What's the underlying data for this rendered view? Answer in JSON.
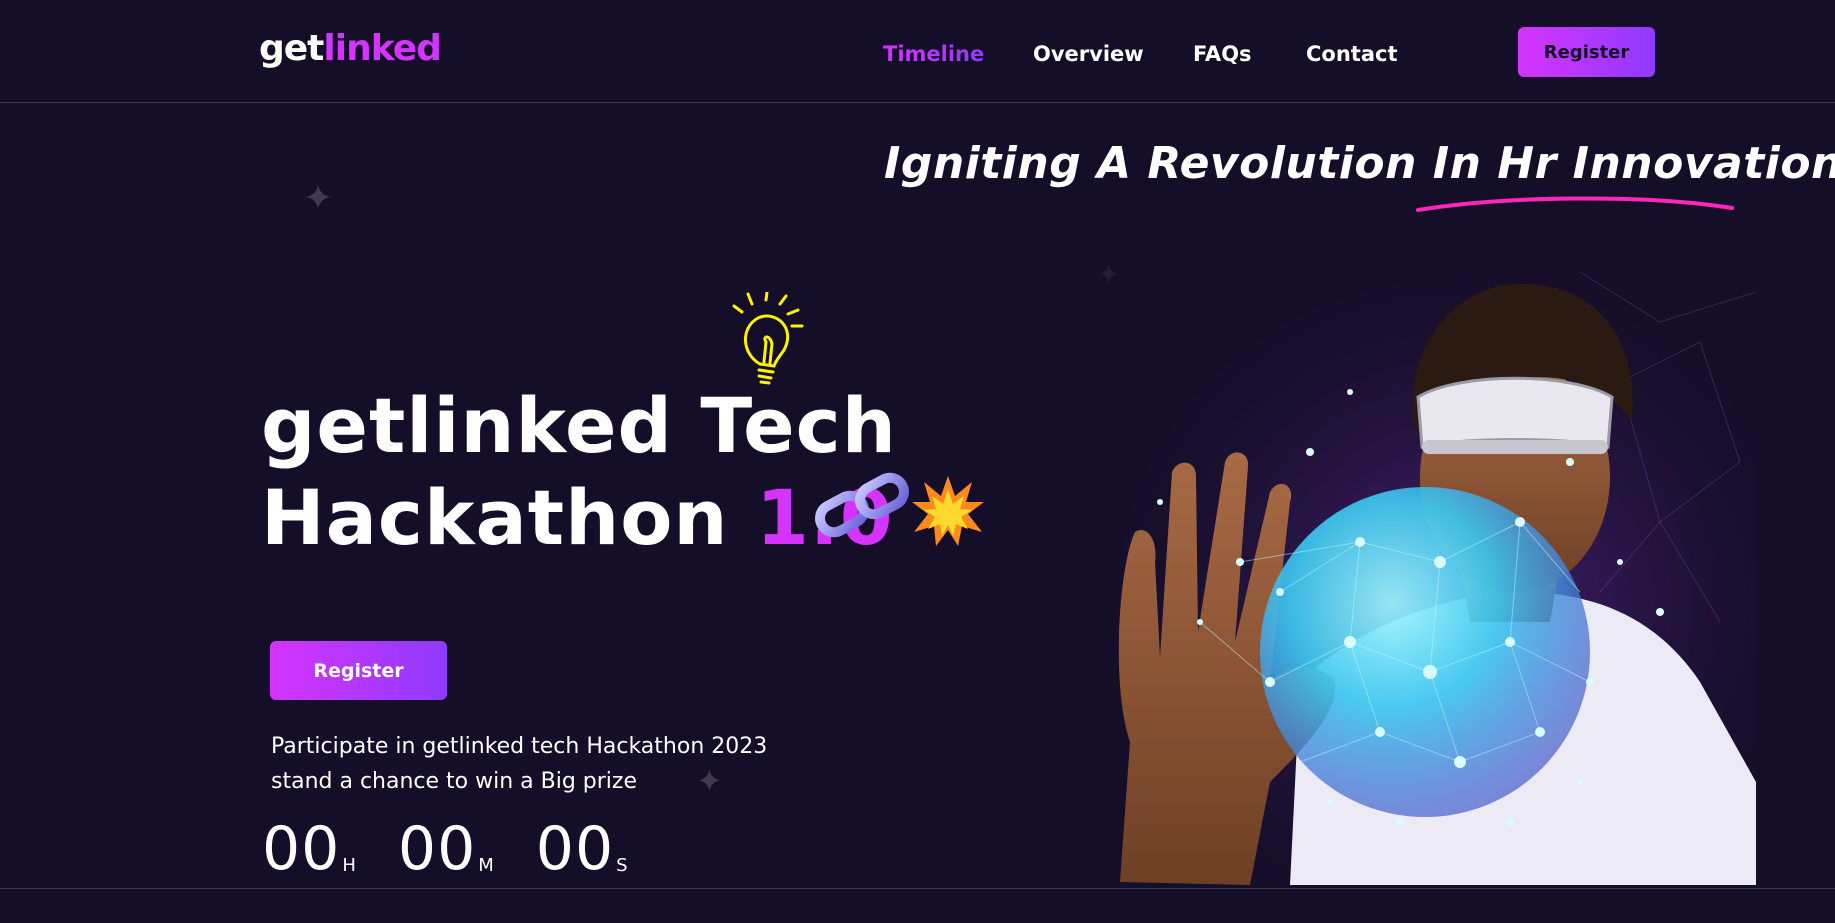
{
  "brand": {
    "logo_part1": "get",
    "logo_part2": "linked"
  },
  "nav": {
    "links": [
      "Timeline",
      "Overview",
      "FAQs",
      "Contact"
    ],
    "register_label": "Register"
  },
  "hero": {
    "tagline": "Igniting A Revolution In Hr Innovation",
    "title_line1": "getlinked Tech",
    "title_line2": "Hackathon",
    "title_version": "1.0",
    "register_label": "Register",
    "description": "Participate in getlinked tech Hackathon 2023 stand a chance to win a Big prize",
    "countdown": {
      "hours": "00",
      "hours_unit": "H",
      "minutes": "00",
      "minutes_unit": "M",
      "seconds": "00",
      "seconds_unit": "S"
    }
  },
  "colors": {
    "background": "#150e28",
    "accent_pink": "#d434fe",
    "accent_purple": "#903aff",
    "underline": "#ff26b9"
  },
  "icons": [
    "lightbulb-icon",
    "chain-link-icon",
    "explosion-icon",
    "sparkle-star-icon"
  ]
}
